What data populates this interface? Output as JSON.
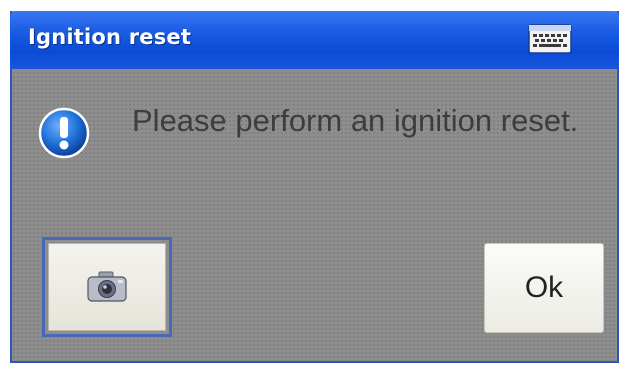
{
  "dialog": {
    "title": "Ignition reset",
    "message": "Please perform an ignition reset.",
    "ok_label": "Ok"
  },
  "icons": {
    "keyboard": "keyboard-icon",
    "info": "exclamation-info-icon",
    "camera": "camera-icon"
  },
  "colors": {
    "title_bar": "#0a4bd6",
    "window_body": "#8e8e8e",
    "info_icon": "#1e6fd6"
  }
}
